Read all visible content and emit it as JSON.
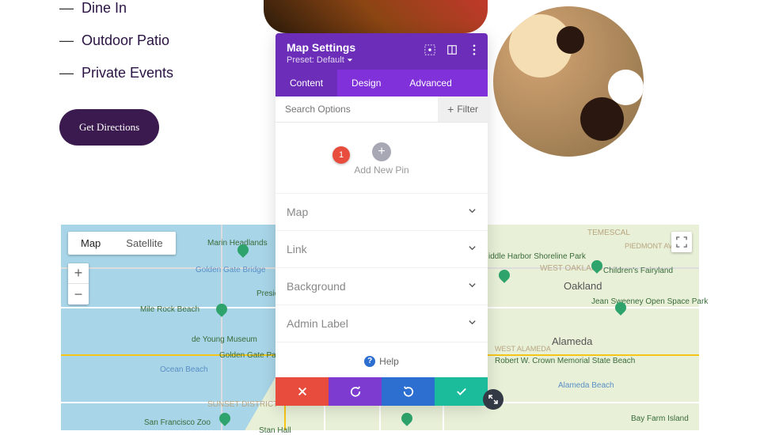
{
  "bullets": {
    "b1": "Dine In",
    "b2": "Outdoor Patio",
    "b3": "Private Events"
  },
  "cta": {
    "label": "Get Directions"
  },
  "modal": {
    "title": "Map Settings",
    "preset": "Preset: Default",
    "tabs": {
      "content": "Content",
      "design": "Design",
      "advanced": "Advanced"
    },
    "search_placeholder": "Search Options",
    "filter": "Filter",
    "add_pin": "Add New Pin",
    "marker": "1",
    "sections": {
      "map": "Map",
      "link": "Link",
      "background": "Background",
      "admin": "Admin Label"
    },
    "help": "Help"
  },
  "map": {
    "tab_map": "Map",
    "tab_sat": "Satellite",
    "zoom_in": "+",
    "zoom_out": "−",
    "labels": {
      "marin": "Marin Headlands",
      "golden": "Golden Gate Bridge",
      "youngmus": "de Young Museum",
      "ggpark": "Golden Gate Park",
      "ocean": "Ocean Beach",
      "sunset": "SUNSET DISTRICT",
      "millrock": "Mile Rock Beach",
      "presidio": "Presidio of San Francisco",
      "sfzoo": "San Francisco Zoo",
      "stanhall": "Stan Hall",
      "temescal": "TEMESCAL",
      "piedmont": "PIEDMONT AVE",
      "middle": "iddle Harbor Shoreline Park",
      "westoak": "WEST OAKLAND",
      "childrens": "Children's Fairyland",
      "oakland": "Oakland",
      "jeansw": "Jean Sweeney Open Space Park",
      "alameda": "Alameda",
      "westalameda": "WEST ALAMEDA",
      "crown": "Robert W. Crown Memorial State Beach",
      "alamedabeach": "Alameda Beach",
      "bayfarm": "Bay Farm Island"
    }
  }
}
